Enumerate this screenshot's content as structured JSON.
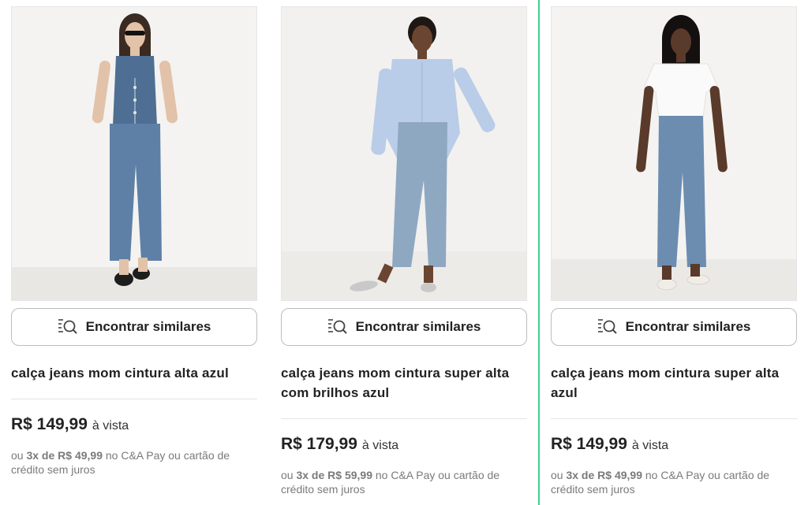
{
  "products": [
    {
      "find_similar_label": "Encontrar similares",
      "title": "calça jeans mom cintura alta azul",
      "price": "R$ 149,99",
      "price_note": "à vista",
      "install_prefix": "ou",
      "install_bold": "3x de R$ 49,99",
      "install_suffix": "no C&A Pay ou cartão de crédito sem juros",
      "image_alt": "product photo",
      "top_color": "#4e6f93",
      "jeans_color": "#5e80a6"
    },
    {
      "find_similar_label": "Encontrar similares",
      "title": "calça jeans mom cintura super alta com brilhos azul",
      "price": "R$ 179,99",
      "price_note": "à vista",
      "install_prefix": "ou",
      "install_bold": "3x de R$ 59,99",
      "install_suffix": "no C&A Pay ou cartão de crédito sem juros",
      "image_alt": "product photo",
      "top_color": "#b9cce8",
      "jeans_color": "#8fa8c2"
    },
    {
      "find_similar_label": "Encontrar similares",
      "title": "calça jeans mom cintura super alta azul",
      "price": "R$ 149,99",
      "price_note": "à vista",
      "install_prefix": "ou",
      "install_bold": "3x de R$ 49,99",
      "install_suffix": "no C&A Pay ou cartão de crédito sem juros",
      "image_alt": "product photo",
      "top_color": "#fafafa",
      "jeans_color": "#6c8db0"
    }
  ],
  "accent_color": "#3ecf8e"
}
